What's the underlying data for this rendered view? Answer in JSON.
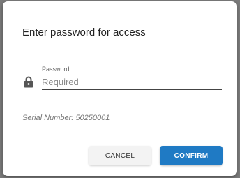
{
  "dialog": {
    "title": "Enter password for access",
    "password_field": {
      "label": "Password",
      "placeholder": "Required",
      "value": "",
      "icon": "lock-icon"
    },
    "serial_text": "Serial Number: 50250001",
    "buttons": {
      "cancel_label": "CANCEL",
      "confirm_label": "CONFIRM"
    }
  },
  "colors": {
    "confirm_button": "#1f7ac4",
    "cancel_button": "#f3f3f3",
    "overlay": "#7a7a7a"
  }
}
